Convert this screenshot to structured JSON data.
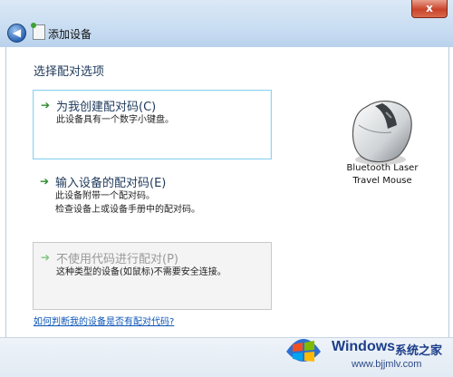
{
  "window": {
    "title": "添加设备",
    "close_glyph": "x",
    "back_glyph": "◀"
  },
  "main": {
    "heading": "选择配对选项",
    "options": [
      {
        "arrow": "➔",
        "title": "为我创建配对码(C)",
        "desc_lines": [
          "此设备具有一个数字小键盘。"
        ]
      },
      {
        "arrow": "➔",
        "title": "输入设备的配对码(E)",
        "desc_lines": [
          "此设备附带一个配对码。",
          "检查设备上或设备手册中的配对码。"
        ]
      },
      {
        "arrow": "➔",
        "title": "不使用代码进行配对(P)",
        "desc_lines": [
          "这种类型的设备(如鼠标)不需要安全连接。"
        ]
      }
    ],
    "device": {
      "name_line1": "Bluetooth Laser",
      "name_line2": "Travel Mouse"
    },
    "help_link": "如何判断我的设备是否有配对代码?"
  },
  "watermark": {
    "brand": "Windows",
    "sub": "系统之家",
    "url": "www.bjjmlv.com"
  }
}
